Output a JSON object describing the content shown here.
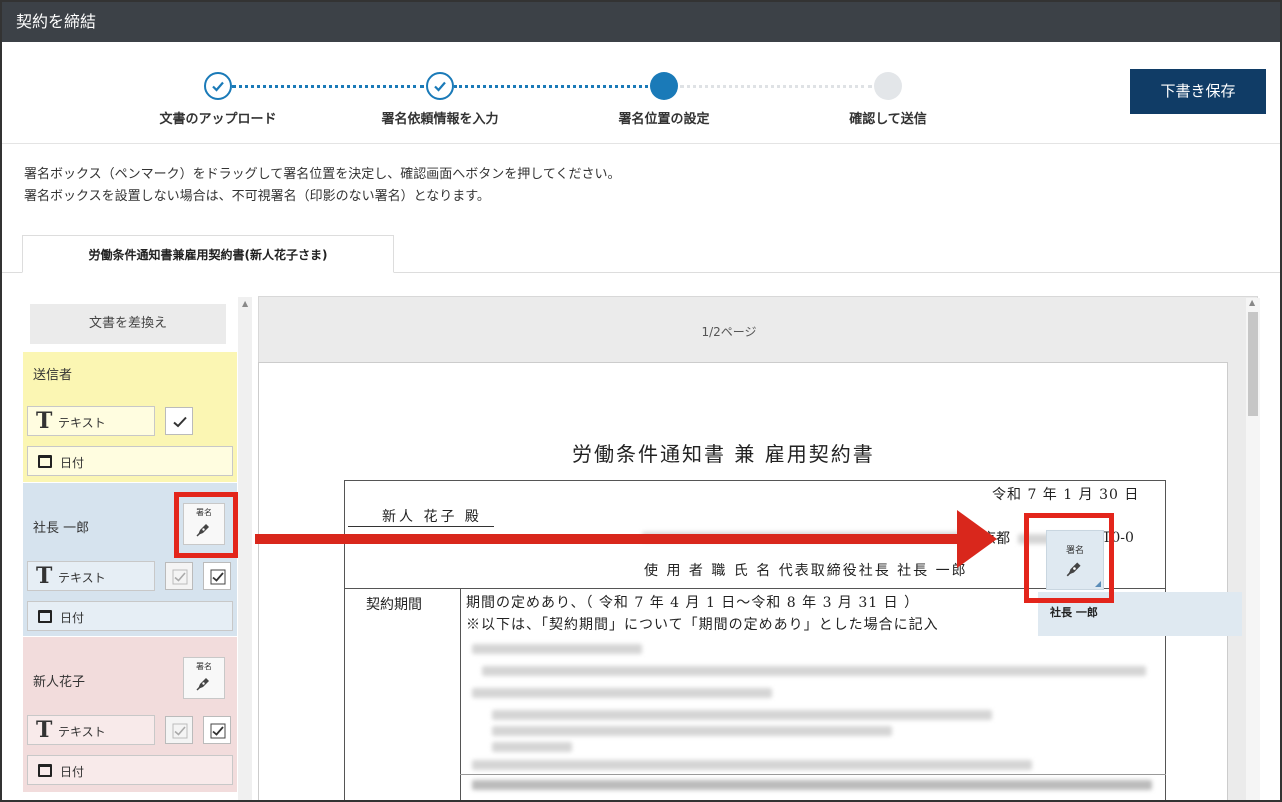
{
  "window": {
    "title": "契約を締結"
  },
  "stepper": {
    "steps": [
      {
        "label": "文書のアップロード",
        "status": "done"
      },
      {
        "label": "署名依頼情報を入力",
        "status": "done"
      },
      {
        "label": "署名位置の設定",
        "status": "current"
      },
      {
        "label": "確認して送信",
        "status": "todo"
      }
    ],
    "draft_button": "下書き保存"
  },
  "instructions": [
    "署名ボックス（ペンマーク）をドラッグして署名位置を決定し、確認画面へボタンを押してください。",
    "署名ボックスを設置しない場合は、不可視署名（印影のない署名）となります。"
  ],
  "document_tab": "労働条件通知書兼雇用契約書(新人花子さま)",
  "left_panel": {
    "replace_button": "文書を差換え",
    "parties": [
      {
        "name": "送信者",
        "text_field": "テキスト",
        "date_field": "日付",
        "color": "#fbf6b3"
      },
      {
        "name": "社長 一郎",
        "signature_label": "署名",
        "text_field": "テキスト",
        "date_field": "日付",
        "color": "#d6e3ee"
      },
      {
        "name": "新人花子",
        "signature_label": "署名",
        "text_field": "テキスト",
        "date_field": "日付",
        "color": "#f2dcdc"
      }
    ]
  },
  "viewer": {
    "page_indicator": "1/2ページ",
    "document": {
      "title": "労働条件通知書 兼 雇用契約書",
      "date": "令和 7 年 1 月 30 日",
      "addressee": "新人 花子  殿",
      "address_visible": "京都",
      "address_tail": "T0-0",
      "employer_line": "使 用 者 職 氏 名   代表取締役社長   社長 一郎",
      "period_label": "契約期間",
      "period_text": "期間の定めあり、（   令和 7 年 4 月 1 日～令和 8 年 3 月 31 日 ）",
      "period_note": "※以下は、「契約期間」について「期間の定めあり」とした場合に記入"
    },
    "placed_signature": {
      "label": "署名",
      "owner": "社長 一郎"
    }
  },
  "colors": {
    "accent": "#1a7ab8",
    "titlebar": "#3c4147",
    "primary_button": "#103c66",
    "annotation": "#e3251b"
  }
}
